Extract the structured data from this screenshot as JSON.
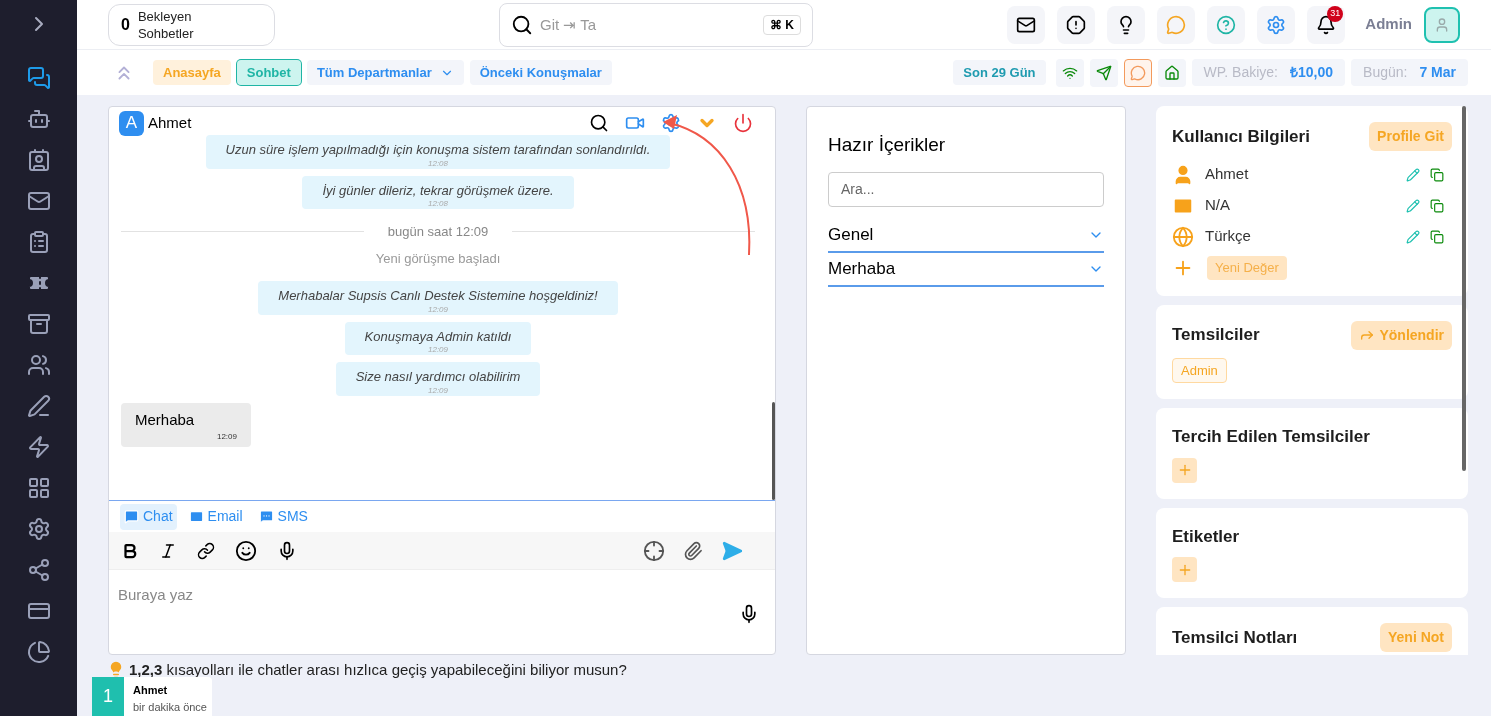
{
  "sidebar": [
    {
      "selected": true
    },
    {
      "selected": false
    },
    {
      "selected": false
    },
    {
      "selected": false
    },
    {
      "selected": false
    },
    {
      "selected": false
    },
    {
      "selected": false
    },
    {
      "selected": false
    },
    {
      "selected": false
    },
    {
      "selected": false
    },
    {
      "selected": false
    },
    {
      "selected": false
    },
    {
      "selected": false
    },
    {
      "selected": false
    },
    {
      "selected": false
    }
  ],
  "header": {
    "pending": {
      "count": "0",
      "label": "Bekleyen Sohbetler"
    },
    "search": {
      "placeholder": "Git ⇥ Ta",
      "shortcut": "⌘ K"
    },
    "notifications": "31",
    "user": "Admin"
  },
  "nav": [
    {
      "label": "Anasayfa",
      "kind": "home",
      "selected": false
    },
    {
      "label": "Sohbet",
      "kind": "chat",
      "selected": true
    },
    {
      "label": "Tüm Departmanlar",
      "kind": "dropdown",
      "selected": false
    },
    {
      "label": "Önceki Konuşmalar",
      "kind": "link",
      "selected": false
    }
  ],
  "period": "Son 29 Gün",
  "channels": [
    {
      "kind": "wifi",
      "selected": false
    },
    {
      "kind": "telegram",
      "selected": false
    },
    {
      "kind": "whatsapp",
      "selected": true
    },
    {
      "kind": "home",
      "selected": false
    }
  ],
  "balance": {
    "label": "WP. Bakiye:",
    "value": "₺10,00"
  },
  "today": {
    "label": "Bugün:",
    "value": "7 Mar"
  },
  "chat": {
    "contact_initial": "A",
    "contact": "Ahmet",
    "messages": [
      {
        "kind": "system",
        "text": "Uzun süre işlem yapılmadığı için konuşma sistem tarafından sonlandırıldı.",
        "time": "12:08"
      },
      {
        "kind": "system",
        "text": "İyi günler dileriz, tekrar görüşmek üzere.",
        "time": "12:08"
      },
      {
        "kind": "divider",
        "text": "bugün saat 12:09"
      },
      {
        "kind": "notice",
        "text": "Yeni görüşme başladı"
      },
      {
        "kind": "system",
        "text": "Merhabalar Supsis Canlı Destek Sistemine hoşgeldiniz!",
        "time": "12:09"
      },
      {
        "kind": "system",
        "text": "Konuşmaya Admin katıldı",
        "time": "12:09"
      },
      {
        "kind": "system",
        "text": "Size nasıl yardımcı olabilirim",
        "time": "12:09"
      },
      {
        "kind": "incoming",
        "text": "Merhaba",
        "time": "12:09"
      }
    ],
    "tabs": [
      {
        "label": "Chat",
        "kind": "chat",
        "selected": true
      },
      {
        "label": "Email",
        "kind": "email",
        "selected": false
      },
      {
        "label": "SMS",
        "kind": "sms",
        "selected": false
      }
    ],
    "composer_placeholder": "Buraya yaz"
  },
  "tip": "**1,2,3** kısayolları ile chatler arası hızlıca geçiş yapabileceğini biliyor musun?",
  "active_chat": {
    "number": "1",
    "name": "Ahmet",
    "time": "bir dakika önce"
  },
  "canned": {
    "title": "Hazır İçerikler",
    "placeholder": "Ara...",
    "groups": [
      {
        "label": "Genel",
        "expanded": false
      },
      {
        "label": "Merhaba",
        "expanded": false
      }
    ]
  },
  "user_info": {
    "title": "Kullanıcı Bilgileri",
    "action": "Profile Git",
    "fields": [
      {
        "kind": "person",
        "value": "Ahmet"
      },
      {
        "kind": "email",
        "value": "N/A"
      },
      {
        "kind": "language",
        "value": "Türkçe"
      }
    ],
    "add": "Yeni Değer"
  },
  "agents": {
    "title": "Temsilciler",
    "action": "Yönlendir",
    "tags": [
      "Admin"
    ]
  },
  "preferred": {
    "title": "Tercih Edilen Temsilciler"
  },
  "labels": {
    "title": "Etiketler"
  },
  "notes": {
    "title": "Temsilci Notları",
    "action": "Yeni Not"
  }
}
